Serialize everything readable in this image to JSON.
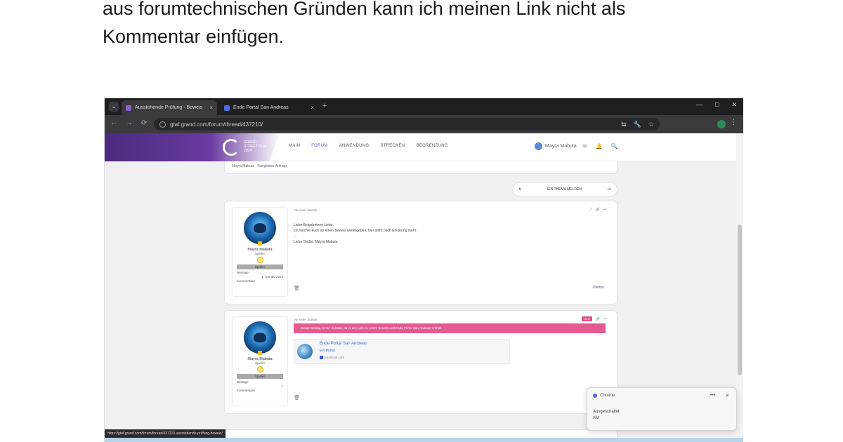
{
  "intro": {
    "line1": "aus forumtechnischen Gründen kann ich meinen Link nicht als",
    "line2": "Kommentar einfügen."
  },
  "browser": {
    "tabs": [
      {
        "title": "Ausstehende Prüfung - Beweis",
        "favicon_color": "#8a63c8",
        "close": "×"
      },
      {
        "title": "Ende Portal San Andreas",
        "favicon_color": "#4a6ee0",
        "close": "×"
      }
    ],
    "new_tab": "+",
    "tab_dropdown": "⌄",
    "window_controls": [
      "—",
      "□",
      "✕"
    ],
    "nav": [
      "←",
      "→",
      "⟳"
    ],
    "url": "gtaf.grand.com/forum/thread/437210/",
    "omni_icons": [
      "⇆",
      "🔧",
      "☆"
    ],
    "menu": "⋮"
  },
  "site": {
    "brand_lines": [
      "GRAND",
      "STREET PLAY",
      "2024"
    ],
    "nav_links": [
      "MAIN",
      "FORUM",
      "ANWENDUNG",
      "STRECKEN",
      "BEGRENZUNG"
    ],
    "user_name": "Mayra Mabuta",
    "nav_icons": [
      "✉",
      "🔔",
      "🔍"
    ]
  },
  "thread": {
    "top_card_text": "Mayra Mabuta · Ranglisten-Anfrage",
    "action_bar": {
      "icon": "⇅",
      "label": "EIN THEMA MELDEN",
      "more": "•••"
    },
    "posts": [
      {
        "author": "Mayra Mabuta",
        "role": "Spieler",
        "rank": "Spieler",
        "meta": [
          "Beiträge",
          "1. Stunde 2024",
          "Kommentare"
        ],
        "date": "Vor einer Stunde",
        "tools": [
          "⤴",
          "🔗",
          "•••"
        ],
        "lines": [
          "Liebe Beigetretene Liebe,",
          "ich möchte euch an einen Beweis weitergeben, hier steht noch Erklärung mehr.",
          "...",
          "Liebe Grüße, Mayra Mabuta"
        ],
        "foot_left": "🗑",
        "foot_right": "Zitieren"
      },
      {
        "author": "Mayra Mabuta",
        "role": "Spieler",
        "rank": "Spieler",
        "meta": [
          "Beiträge",
          "1",
          "Kommentare"
        ],
        "date": "Vor einer Stunde",
        "tools": [
          "NEU",
          "🔗",
          "•••"
        ],
        "warning": "Dieser Beitrag ist nur sichtbar, da er den Link zu einem Beweis und Ende Portal San Andreas enthält.",
        "embed": {
          "title": "Ende Portal San Andreas",
          "subtitle": "Ein Portal",
          "source": "facebook.com"
        },
        "foot_left": "🗑"
      }
    ]
  },
  "toast": {
    "app": "Chrome",
    "controls": [
      "•••",
      "✕"
    ],
    "lines": [
      "Ausgeschaltet",
      "AM"
    ]
  },
  "status_url": "https://gtaf.grand.com/forum/thread/437210-ausstehende-prüfung-beweis/"
}
